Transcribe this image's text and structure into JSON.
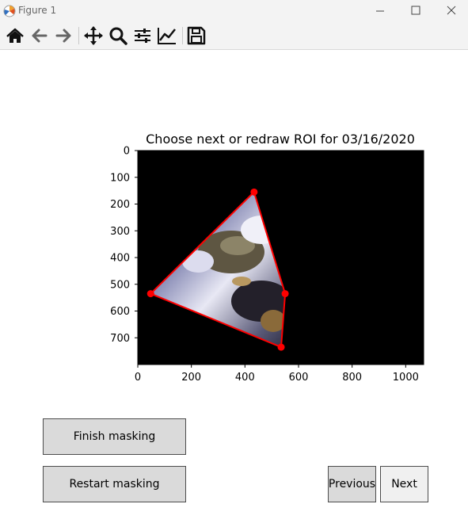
{
  "window": {
    "title": "Figure 1",
    "buttons": [
      "minimize-icon",
      "maximize-icon",
      "close-icon"
    ]
  },
  "toolbar": {
    "tools": [
      "home-icon",
      "back-arrow-icon",
      "forward-arrow-icon",
      "pan-icon",
      "zoom-icon",
      "configure-subplots-icon",
      "edit-axis-icon",
      "save-icon"
    ]
  },
  "plot": {
    "title": "Choose next or redraw ROI for 03/16/2020",
    "x_ticks": [
      "0",
      "200",
      "400",
      "600",
      "800",
      "1000"
    ],
    "y_ticks": [
      "0",
      "100",
      "200",
      "300",
      "400",
      "500",
      "600",
      "700"
    ],
    "xlim": [
      0,
      1067
    ],
    "ylim": [
      800,
      0
    ],
    "background": "#000000",
    "roi_color": "#ff0000",
    "roi_points": [
      [
        434,
        155
      ],
      [
        550,
        535
      ],
      [
        535,
        735
      ],
      [
        48,
        535
      ]
    ]
  },
  "buttons": {
    "finish": "Finish masking",
    "restart": "Restart masking",
    "previous": "Previous",
    "next": "Next"
  }
}
